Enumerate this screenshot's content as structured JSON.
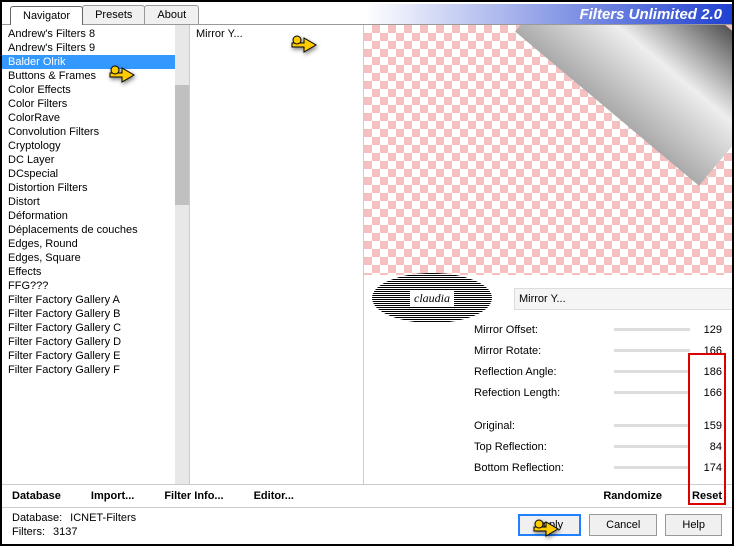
{
  "app_title": "Filters Unlimited 2.0",
  "tabs": [
    "Navigator",
    "Presets",
    "About"
  ],
  "active_tab": 0,
  "categories": [
    "Andrew's Filters 8",
    "Andrew's Filters 9",
    "Balder Olrik",
    "Buttons & Frames",
    "Color Effects",
    "Color Filters",
    "ColorRave",
    "Convolution Filters",
    "Cryptology",
    "DC Layer",
    "DCspecial",
    "Distortion Filters",
    "Distort",
    "Déformation",
    "Déplacements de couches",
    "Edges, Round",
    "Edges, Square",
    "Effects",
    "FFG???",
    "Filter Factory Gallery A",
    "Filter Factory Gallery B",
    "Filter Factory Gallery C",
    "Filter Factory Gallery D",
    "Filter Factory Gallery E",
    "Filter Factory Gallery F"
  ],
  "selected_category": 2,
  "filters": [
    "Mirror Y..."
  ],
  "current_filter": "Mirror Y...",
  "watermark": "claudia",
  "params": [
    {
      "label": "Mirror Offset:",
      "value": 129
    },
    {
      "label": "Mirror Rotate:",
      "value": 166
    },
    {
      "label": "Reflection Angle:",
      "value": 186
    },
    {
      "label": "Refection Length:",
      "value": 166
    }
  ],
  "params2": [
    {
      "label": "Original:",
      "value": 159
    },
    {
      "label": "Top Reflection:",
      "value": 84
    },
    {
      "label": "Bottom Reflection:",
      "value": 174
    }
  ],
  "toolbar": {
    "database": "Database",
    "import": "Import...",
    "filter_info": "Filter Info...",
    "editor": "Editor...",
    "randomize": "Randomize",
    "reset": "Reset"
  },
  "footer": {
    "db_label": "Database:",
    "db_value": "ICNET-Filters",
    "filters_label": "Filters:",
    "filters_value": "3137",
    "apply": "Apply",
    "cancel": "Cancel",
    "help": "Help"
  }
}
